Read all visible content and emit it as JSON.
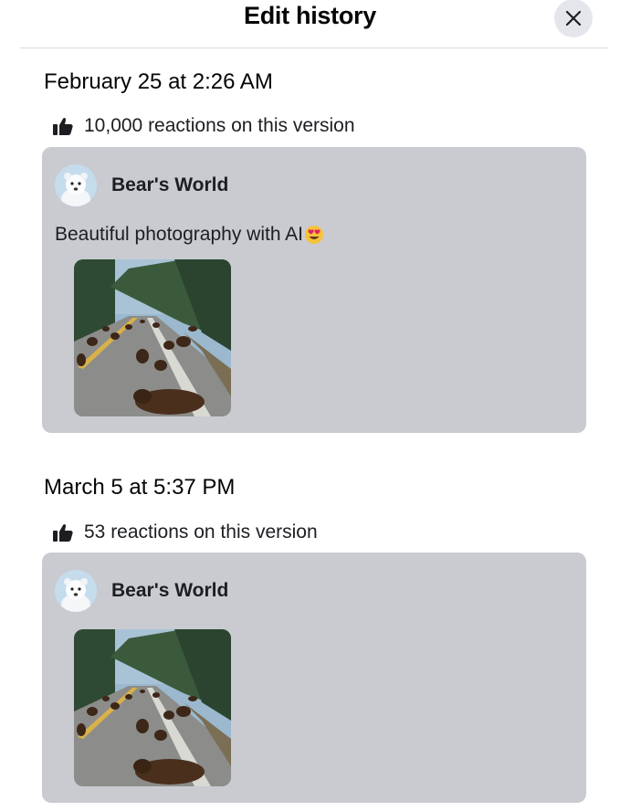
{
  "header": {
    "title": "Edit history",
    "close_icon": "close-icon"
  },
  "versions": [
    {
      "date": "February 25 at 2:26 AM",
      "reactions": "10,000 reactions on this version",
      "author": "Bear's World",
      "text": "Beautiful photography with AI",
      "text_emoji": "heart-eyes-emoji",
      "photo": "bears-on-road-photo"
    },
    {
      "date": "March 5 at 5:37 PM",
      "reactions": "53 reactions on this version",
      "author": "Bear's World",
      "photo": "bears-on-road-photo"
    }
  ],
  "colors": {
    "card_bg": "#c9cbd1",
    "close_bg": "#e4e6eb",
    "divider": "#d8dadf"
  }
}
